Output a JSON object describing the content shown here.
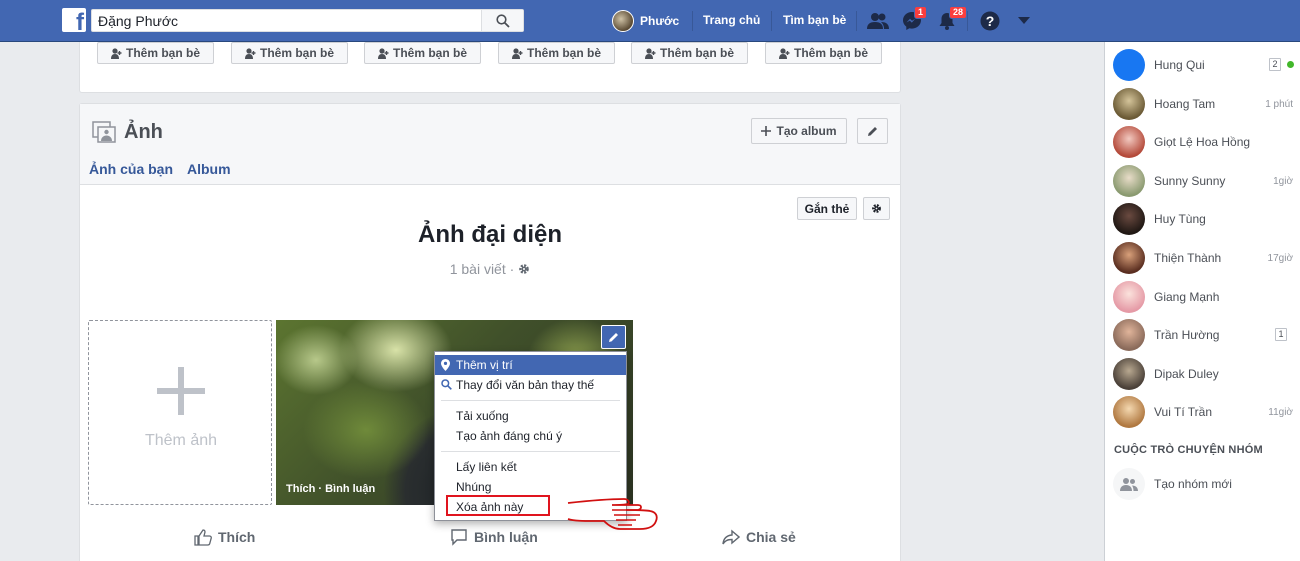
{
  "topbar": {
    "logo": "f",
    "search_value": "Đặng Phước",
    "user_name": "Phước",
    "home_label": "Trang chủ",
    "find_friends_label": "Tìm bạn bè",
    "messages_badge": "1",
    "notifications_badge": "28",
    "brand_color": "#4267b2"
  },
  "friend_strip": {
    "buttons": [
      "Thêm bạn bè",
      "Thêm bạn bè",
      "Thêm bạn bè",
      "Thêm bạn bè",
      "Thêm bạn bè",
      "Thêm bạn bè"
    ]
  },
  "photos": {
    "title": "Ảnh",
    "create_album": "Tạo album",
    "tabs": [
      "Ảnh của bạn",
      "Album"
    ],
    "tag_button": "Gắn thẻ",
    "album_title": "Ảnh đại diện",
    "album_meta": "1 bài viết ·",
    "add_photo": "Thêm ảnh",
    "photo_caption": "Thích · Bình luận",
    "menu": {
      "items": [
        "Thêm vị trí",
        "Thay đổi văn bản thay thế",
        "Tải xuống",
        "Tạo ảnh đáng chú ý",
        "Lấy liên kết",
        "Nhúng",
        "Xóa ảnh này"
      ]
    },
    "actions": {
      "like": "Thích",
      "comment": "Bình luận",
      "share": "Chia sẻ"
    }
  },
  "sidebar": {
    "contacts": [
      {
        "name": "Hung Qui",
        "time": "",
        "count": "2",
        "online": true
      },
      {
        "name": "Hoang Tam",
        "time": "1 phút",
        "count": "",
        "online": false
      },
      {
        "name": "Giọt Lệ Hoa Hồng",
        "time": "",
        "count": "",
        "online": false
      },
      {
        "name": "Sunny Sunny",
        "time": "1giờ",
        "count": "",
        "online": false
      },
      {
        "name": "Huy Tùng",
        "time": "",
        "count": "",
        "online": false
      },
      {
        "name": "Thiện Thành",
        "time": "17giờ",
        "count": "",
        "online": false
      },
      {
        "name": "Giang Mạnh",
        "time": "",
        "count": "",
        "online": false
      },
      {
        "name": "Trần Hường",
        "time": "",
        "count": "1",
        "online": false
      },
      {
        "name": "Dipak Duley",
        "time": "",
        "count": "",
        "online": false
      },
      {
        "name": "Vui Tí Trần",
        "time": "11giờ",
        "count": "",
        "online": false
      }
    ],
    "group_title": "CUỘC TRÒ CHUYỆN NHÓM",
    "new_group": "Tạo nhóm mới"
  }
}
